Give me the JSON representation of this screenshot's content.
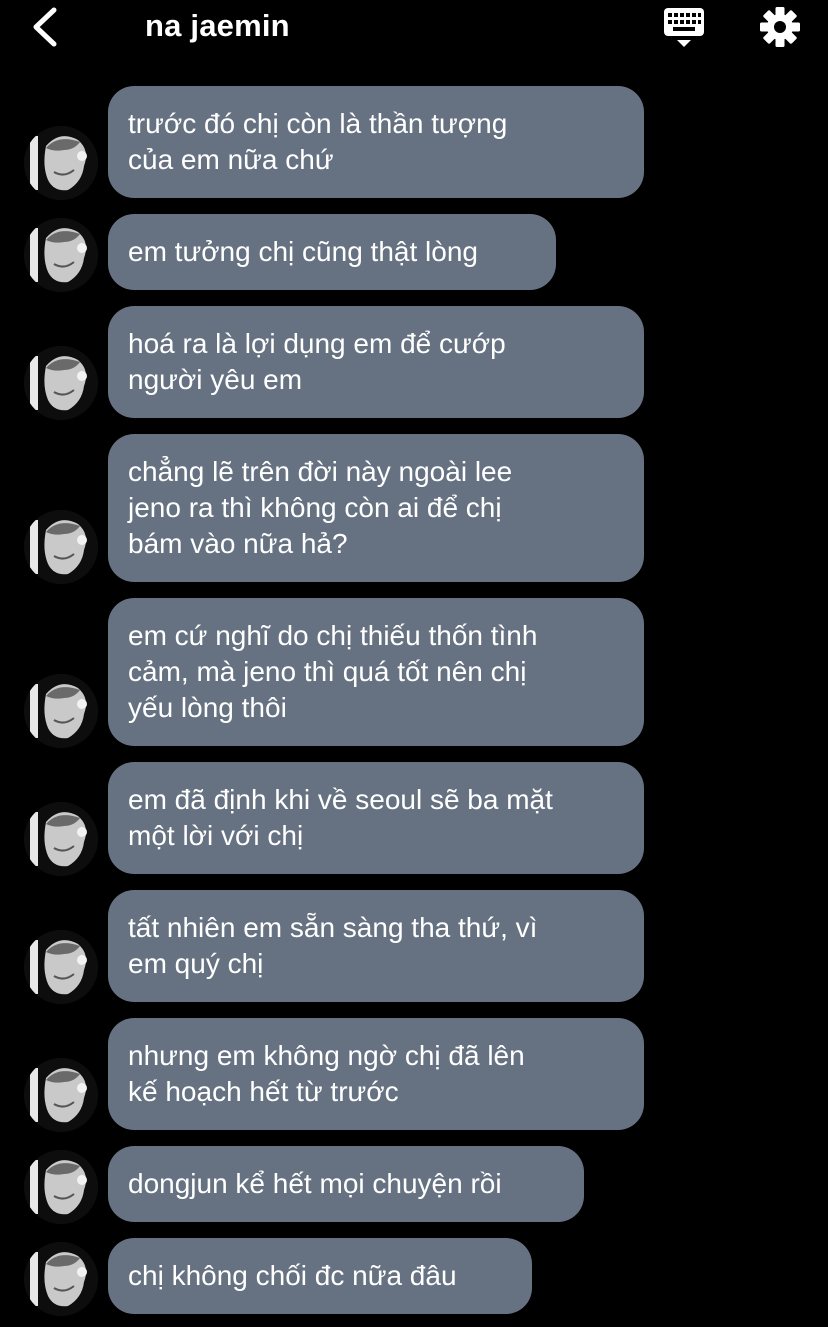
{
  "header": {
    "title": "na jaemin",
    "back_icon": "chevron-left-icon",
    "keyboard_icon": "keyboard-icon",
    "settings_icon": "gear-icon"
  },
  "colors": {
    "background": "#000000",
    "bubble": "#667282",
    "text": "#ffffff"
  },
  "messages": [
    {
      "text": "trước đó chị còn là thần tượng\ncủa em nữa chứ"
    },
    {
      "text": "em tưởng chị cũng thật lòng"
    },
    {
      "text": "hoá ra là lợi dụng em để cướp\nngười yêu em"
    },
    {
      "text": "chẳng lẽ trên đời này ngoài lee\njeno ra thì không còn ai để chị\nbám vào nữa hả?"
    },
    {
      "text": "em cứ nghĩ do chị thiếu thốn tình\ncảm, mà jeno thì quá tốt nên chị\nyếu lòng thôi"
    },
    {
      "text": "em đã định khi về seoul sẽ ba mặt\nmột lời với chị"
    },
    {
      "text": "tất nhiên em sẵn sàng tha thứ, vì\nem quý chị"
    },
    {
      "text": "nhưng em không ngờ chị đã lên\nkế hoạch hết từ trước"
    },
    {
      "text": "dongjun kể hết mọi chuyện rồi"
    },
    {
      "text": "chị không chối đc nữa đâu"
    }
  ]
}
